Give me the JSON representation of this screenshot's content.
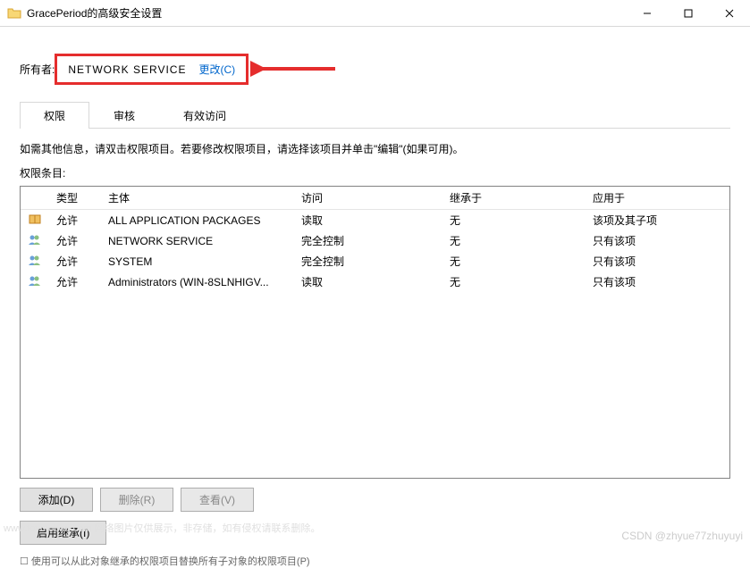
{
  "window": {
    "title": "GracePeriod的高级安全设置"
  },
  "owner": {
    "label": "所有者:",
    "value": "NETWORK SERVICE",
    "change_link": "更改(C)"
  },
  "tabs": {
    "permissions": "权限",
    "auditing": "审核",
    "effective": "有效访问"
  },
  "info_text": "如需其他信息，请双击权限项目。若要修改权限项目，请选择该项目并单击\"编辑\"(如果可用)。",
  "entries_label": "权限条目:",
  "table": {
    "headers": {
      "blank": "",
      "type": "类型",
      "principal": "主体",
      "access": "访问",
      "inherited": "继承于",
      "applies": "应用于"
    },
    "rows": [
      {
        "type": "允许",
        "principal": "ALL APPLICATION PACKAGES",
        "access": "读取",
        "inherited": "无",
        "applies": "该项及其子项",
        "icon": "package"
      },
      {
        "type": "允许",
        "principal": "NETWORK SERVICE",
        "access": "完全控制",
        "inherited": "无",
        "applies": "只有该项",
        "icon": "users"
      },
      {
        "type": "允许",
        "principal": "SYSTEM",
        "access": "完全控制",
        "inherited": "无",
        "applies": "只有该项",
        "icon": "users"
      },
      {
        "type": "允许",
        "principal": "Administrators (WIN-8SLNHIGV...",
        "access": "读取",
        "inherited": "无",
        "applies": "只有该项",
        "icon": "users"
      }
    ]
  },
  "buttons": {
    "add": "添加(D)",
    "remove": "删除(R)",
    "view": "查看(V)",
    "inherit": "启用继承(I)"
  },
  "footer_partial": "使用可以从此对象继承的权限项目替换所有子对象的权限项目(P)",
  "watermark_right": "CSDN @zhyue77zhuyuyi",
  "watermark_left": "www.toymoban.com 网络图片仅供展示，非存储，如有侵权请联系删除。"
}
